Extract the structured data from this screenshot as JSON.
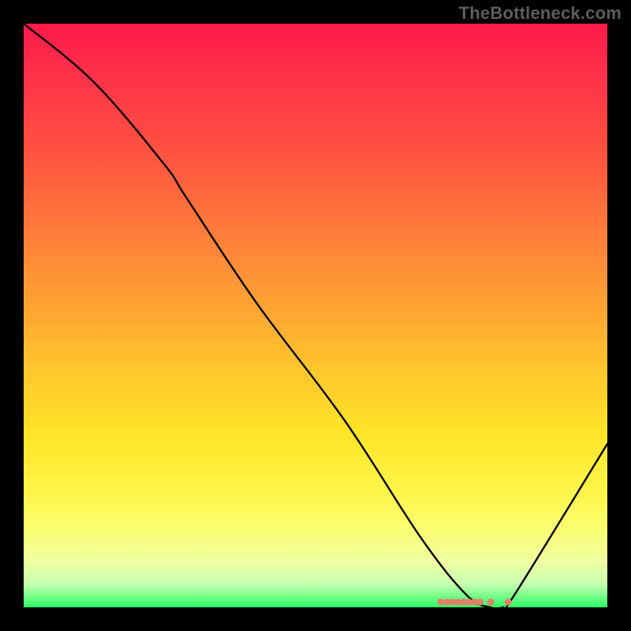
{
  "watermark": "TheBottleneck.com",
  "chart_data": {
    "type": "line",
    "title": "",
    "xlabel": "",
    "ylabel": "",
    "xlim": [
      0,
      100
    ],
    "ylim": [
      0,
      100
    ],
    "series": [
      {
        "name": "bottleneck-curve",
        "x": [
          0,
          12,
          24,
          28,
          40,
          55,
          68,
          76,
          80,
          82,
          84,
          100
        ],
        "values": [
          100,
          90,
          76,
          70,
          52,
          32,
          12,
          2,
          0,
          0,
          2,
          28
        ]
      }
    ],
    "scatter_points": {
      "name": "highlight-dots",
      "color": "#e0806b",
      "points": [
        {
          "x": 71.5,
          "y": 0.9
        },
        {
          "x": 72.6,
          "y": 0.9
        },
        {
          "x": 73.5,
          "y": 0.9
        },
        {
          "x": 74.5,
          "y": 0.9
        },
        {
          "x": 75.4,
          "y": 0.9
        },
        {
          "x": 76.3,
          "y": 0.9
        },
        {
          "x": 77.3,
          "y": 0.9
        },
        {
          "x": 78.2,
          "y": 0.9
        },
        {
          "x": 80.0,
          "y": 0.9
        },
        {
          "x": 83.0,
          "y": 0.9
        }
      ]
    },
    "background_gradient": {
      "top": "#ff1a4a",
      "mid": "#ffe427",
      "bottom": "#2bff64"
    }
  }
}
